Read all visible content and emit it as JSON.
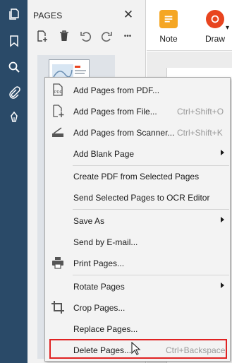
{
  "nav_rail": {
    "items": [
      {
        "name": "pages-icon"
      },
      {
        "name": "bookmark-icon"
      },
      {
        "name": "search-icon"
      },
      {
        "name": "attachment-icon"
      },
      {
        "name": "pen-icon"
      }
    ]
  },
  "panel": {
    "title": "PAGES",
    "close_glyph": "✕",
    "more_glyph": "•••"
  },
  "ribbon": {
    "note_label": "Note",
    "draw_label": "Draw",
    "note_color": "#f5a623",
    "draw_color": "#e8441f"
  },
  "menu": {
    "items": [
      {
        "label": "Add Pages from PDF...",
        "shortcut": ""
      },
      {
        "label": "Add Pages from File...",
        "shortcut": "Ctrl+Shift+O"
      },
      {
        "label": "Add Pages from Scanner...",
        "shortcut": "Ctrl+Shift+K"
      },
      {
        "label": "Add Blank Page",
        "shortcut": ""
      },
      {
        "label": "Create PDF from Selected Pages",
        "shortcut": ""
      },
      {
        "label": "Send Selected Pages to OCR Editor",
        "shortcut": ""
      },
      {
        "label": "Save As",
        "shortcut": ""
      },
      {
        "label": "Send by E-mail...",
        "shortcut": ""
      },
      {
        "label": "Print Pages...",
        "shortcut": ""
      },
      {
        "label": "Rotate Pages",
        "shortcut": ""
      },
      {
        "label": "Crop Pages...",
        "shortcut": ""
      },
      {
        "label": "Replace Pages...",
        "shortcut": ""
      },
      {
        "label": "Delete Pages...",
        "shortcut": "Ctrl+Backspace"
      }
    ]
  },
  "colors": {
    "rail": "#2a4a68",
    "highlight": "#e02222"
  }
}
